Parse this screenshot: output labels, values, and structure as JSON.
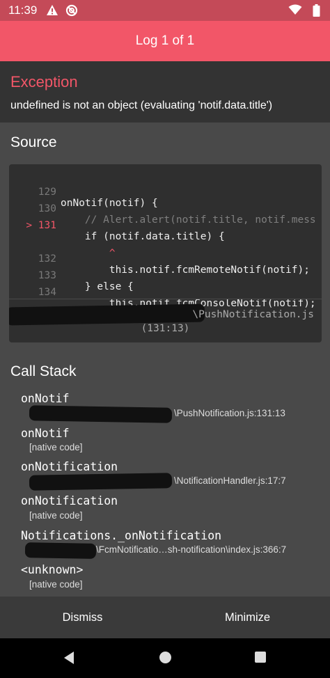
{
  "status_bar": {
    "time": "11:39",
    "icons": [
      "alert-icon",
      "no-entry-icon",
      "wifi-icon",
      "battery-icon"
    ]
  },
  "header": {
    "title": "Log 1 of 1"
  },
  "exception": {
    "title": "Exception",
    "message": "undefined is not an object (evaluating 'notif.data.title')"
  },
  "source": {
    "title": "Source",
    "lines": [
      {
        "num": "129",
        "code": "onNotif(notif) {",
        "style": "normal",
        "active": false
      },
      {
        "num": "130",
        "code": "    // Alert.alert(notif.title, notif.mess",
        "style": "comment",
        "active": false
      },
      {
        "num": "> 131",
        "code": "    if (notif.data.title) {",
        "style": "normal",
        "active": true
      },
      {
        "num": "",
        "code": "        ^",
        "style": "caret",
        "active": false
      },
      {
        "num": "132",
        "code": "        this.notif.fcmRemoteNotif(notif);",
        "style": "normal",
        "active": false
      },
      {
        "num": "133",
        "code": "    } else {",
        "style": "normal",
        "active": false
      },
      {
        "num": "134",
        "code": "        this.notif.fcmConsoleNotif(notif);",
        "style": "normal",
        "active": false
      }
    ],
    "file": "\\PushNotification.js",
    "position": "(131:13)"
  },
  "call_stack": {
    "title": "Call Stack",
    "frames": [
      {
        "name": "onNotif",
        "location": "\\PushNotification.js:131:13"
      },
      {
        "name": "onNotif",
        "location": "[native code]"
      },
      {
        "name": "onNotification",
        "location": "\\NotificationHandler.js:17:7"
      },
      {
        "name": "onNotification",
        "location": "[native code]"
      },
      {
        "name": "Notifications._onNotification",
        "location": "\\FcmNotificatio…sh-notification\\index.js:366:7"
      },
      {
        "name": "<unknown>",
        "location": "[native code]"
      }
    ]
  },
  "buttons": {
    "dismiss": "Dismiss",
    "minimize": "Minimize"
  },
  "colors": {
    "accent": "#f25668",
    "status_bar": "#c44a58",
    "panel": "#494949",
    "code_bg": "#2f2f2f"
  }
}
